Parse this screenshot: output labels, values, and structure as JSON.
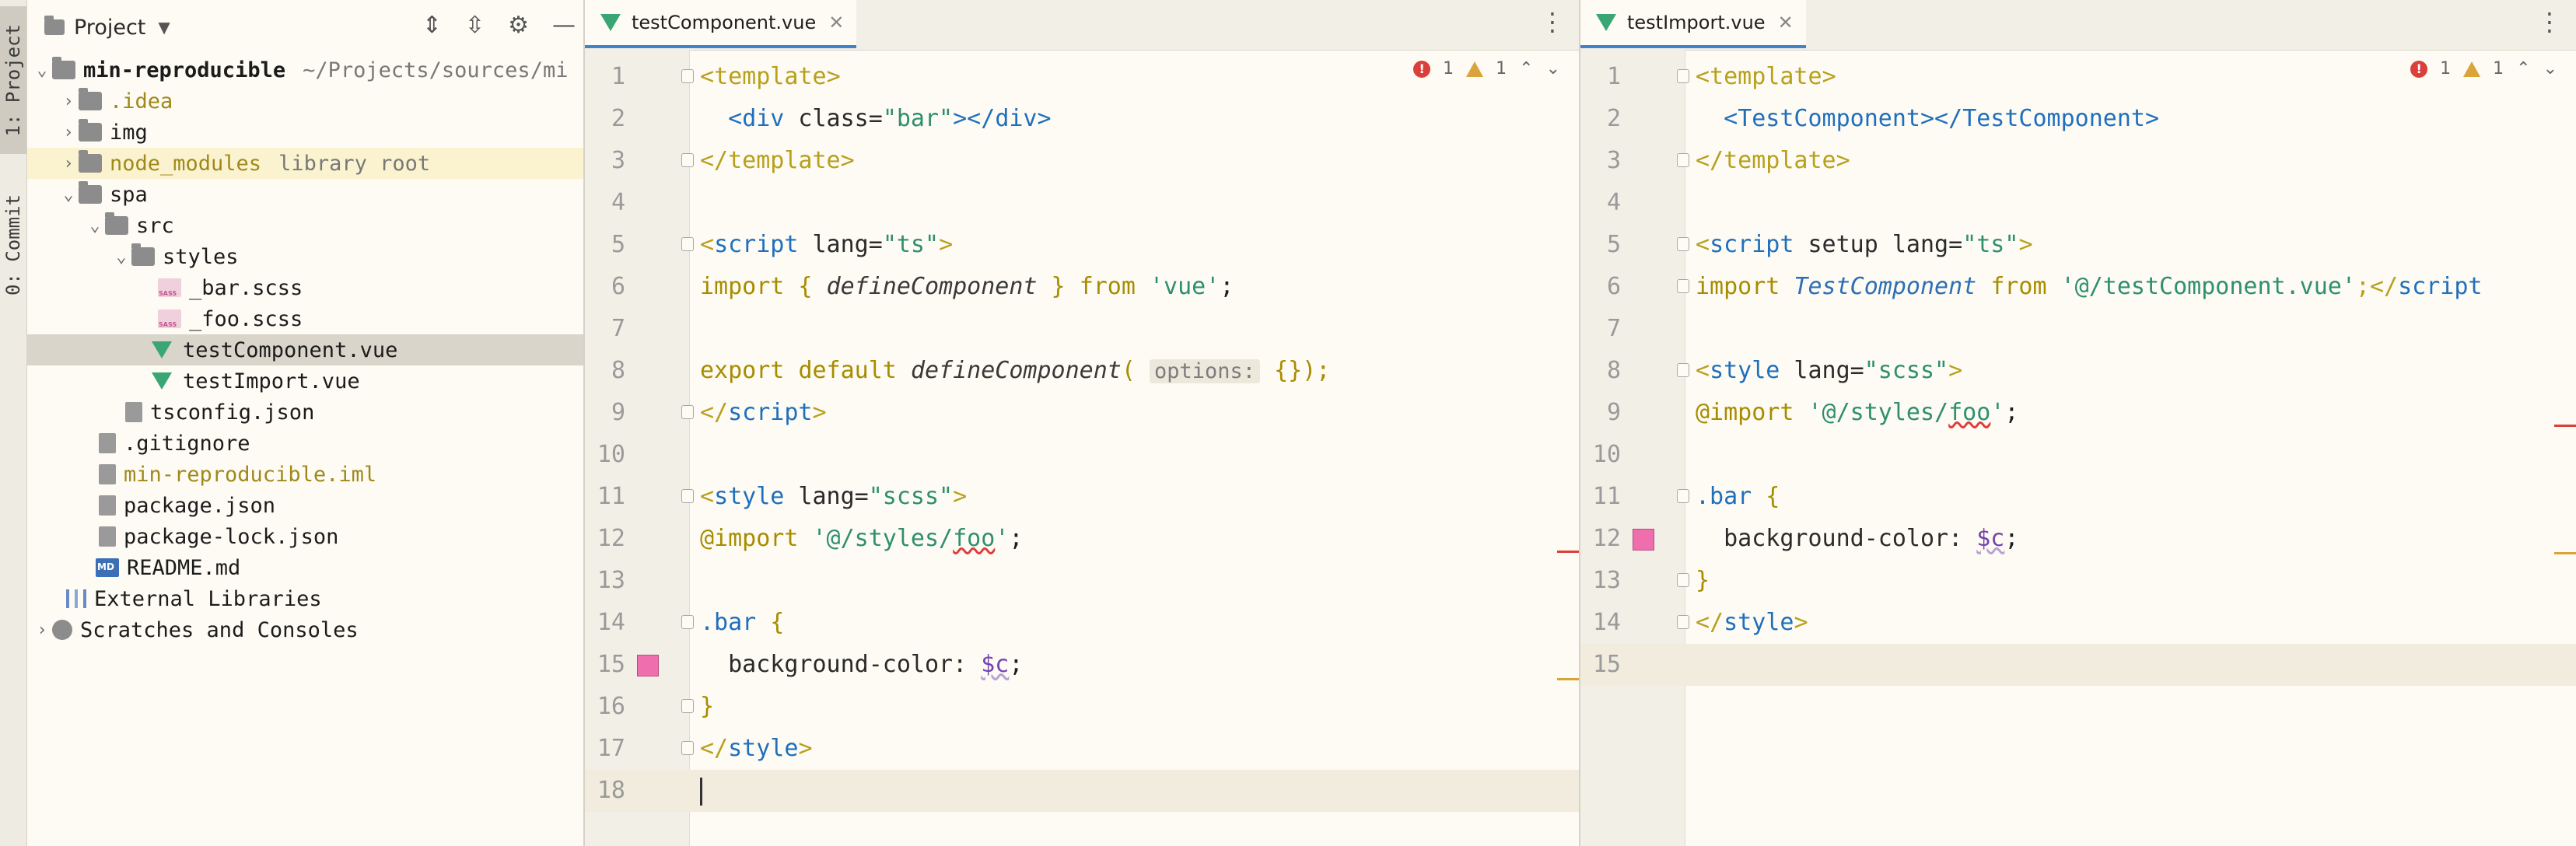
{
  "toolwindows": {
    "project_tab": "1: Project",
    "commit_tab": "0: Commit"
  },
  "project": {
    "title": "Project",
    "tree": [
      {
        "name": "min-reproducible",
        "note": "~/Projects/sources/mi",
        "kind": "folder",
        "depth": 0,
        "expanded": true
      },
      {
        "name": ".idea",
        "kind": "folder",
        "depth": 1
      },
      {
        "name": "img",
        "kind": "folder",
        "depth": 1
      },
      {
        "name": "node_modules",
        "note": "library root",
        "kind": "folder",
        "depth": 1
      },
      {
        "name": "spa",
        "kind": "folder",
        "depth": 1,
        "expanded": true
      },
      {
        "name": "src",
        "kind": "folder",
        "depth": 2,
        "expanded": true
      },
      {
        "name": "styles",
        "kind": "folder",
        "depth": 3,
        "expanded": true
      },
      {
        "name": "_bar.scss",
        "kind": "sass",
        "depth": 4
      },
      {
        "name": "_foo.scss",
        "kind": "sass",
        "depth": 4
      },
      {
        "name": "testComponent.vue",
        "kind": "vue",
        "depth": 3
      },
      {
        "name": "testImport.vue",
        "kind": "vue",
        "depth": 3
      },
      {
        "name": "tsconfig.json",
        "kind": "file",
        "depth": 2
      },
      {
        "name": ".gitignore",
        "kind": "file",
        "depth": 1
      },
      {
        "name": "min-reproducible.iml",
        "kind": "file",
        "depth": 1
      },
      {
        "name": "package.json",
        "kind": "file",
        "depth": 1
      },
      {
        "name": "package-lock.json",
        "kind": "file",
        "depth": 1
      },
      {
        "name": "README.md",
        "kind": "md",
        "depth": 1
      },
      {
        "name": "External Libraries",
        "kind": "lib",
        "depth": 0
      },
      {
        "name": "Scratches and Consoles",
        "kind": "scratch",
        "depth": 0
      }
    ]
  },
  "editor_left": {
    "tab": "testComponent.vue",
    "inspections": {
      "errors": "1",
      "warnings": "1"
    },
    "lines": {
      "l1a": "<",
      "l1b": "template",
      "l1c": ">",
      "l2a": "  <",
      "l2b": "div",
      "l2c": " class=",
      "l2d": "\"bar\"",
      "l2e": "></",
      "l2f": "div",
      "l2g": ">",
      "l3a": "</",
      "l3b": "template",
      "l3c": ">",
      "l5a": "<",
      "l5b": "script",
      "l5c": " lang=",
      "l5d": "\"ts\"",
      "l5e": ">",
      "l6a": "import",
      "l6b": " { ",
      "l6c": "defineComponent",
      "l6d": " } ",
      "l6e": "from",
      "l6f": " ",
      "l6g": "'vue'",
      "l6h": ";",
      "l8a": "export",
      "l8b": " ",
      "l8c": "default",
      "l8d": " ",
      "l8e": "defineComponent",
      "l8f": "( ",
      "l8g": "options:",
      "l8h": " {});",
      "l9a": "</",
      "l9b": "script",
      "l9c": ">",
      "l11a": "<",
      "l11b": "style",
      "l11c": " lang=",
      "l11d": "\"scss\"",
      "l11e": ">",
      "l12a": "@import",
      "l12b": " ",
      "l12c": "'@/styles/",
      "l12d": "foo",
      "l12e": "'",
      "l12f": ";",
      "l14a": ".bar",
      "l14b": " {",
      "l15a": "  background-color: ",
      "l15b": "$c",
      "l15c": ";",
      "l16a": "}",
      "l17a": "</",
      "l17b": "style",
      "l17c": ">"
    }
  },
  "editor_right": {
    "tab": "testImport.vue",
    "inspections": {
      "errors": "1",
      "warnings": "1"
    },
    "lines": {
      "l1a": "<",
      "l1b": "template",
      "l1c": ">",
      "l2a": "  <",
      "l2b": "TestComponent",
      "l2c": "></",
      "l2d": "TestComponent",
      "l2e": ">",
      "l3a": "</",
      "l3b": "template",
      "l3c": ">",
      "l5a": "<",
      "l5b": "script",
      "l5c": " setup lang=",
      "l5d": "\"ts\"",
      "l5e": ">",
      "l6a": "import",
      "l6b": " ",
      "l6c": "TestComponent",
      "l6d": " ",
      "l6e": "from",
      "l6f": " ",
      "l6g": "'@/testComponent.vue'",
      "l6h": ";</",
      "l6i": "script",
      "l8a": "<",
      "l8b": "style",
      "l8c": " lang=",
      "l8d": "\"scss\"",
      "l8e": ">",
      "l9a": "@import",
      "l9b": " ",
      "l9c": "'@/styles/",
      "l9d": "foo",
      "l9e": "'",
      "l9f": ";",
      "l11a": ".bar",
      "l11b": " {",
      "l12a": "  background-color: ",
      "l12b": "$c",
      "l12c": ";",
      "l13a": "}",
      "l14a": "</",
      "l14b": "style",
      "l14c": ">"
    }
  },
  "line_numbers": [
    "1",
    "2",
    "3",
    "4",
    "5",
    "6",
    "7",
    "8",
    "9",
    "10",
    "11",
    "12",
    "13",
    "14",
    "15",
    "16",
    "17",
    "18"
  ],
  "colors": {
    "accent": "#4083c9",
    "error": "#d9403b",
    "warning": "#d9a53b",
    "swatch": "#ef6fae"
  }
}
